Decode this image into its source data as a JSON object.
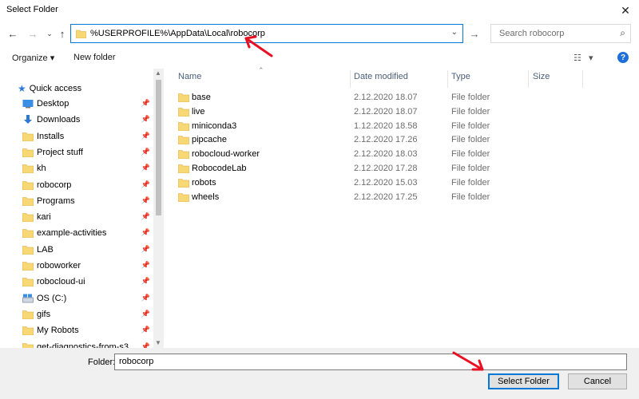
{
  "window": {
    "title": "Select Folder"
  },
  "address": {
    "path": "%USERPROFILE%\\AppData\\Local\\robocorp"
  },
  "search": {
    "placeholder": "Search robocorp"
  },
  "toolbar": {
    "organize": "Organize ▾",
    "new_folder": "New folder",
    "view_label": "▾",
    "help_label": "?"
  },
  "sidebar": {
    "quick_access": "Quick access",
    "items": [
      {
        "label": "Desktop",
        "icon": "desktop-icon"
      },
      {
        "label": "Downloads",
        "icon": "download-icon"
      },
      {
        "label": "Installs",
        "icon": "folder-icon"
      },
      {
        "label": "Project stuff",
        "icon": "folder-icon"
      },
      {
        "label": "kh",
        "icon": "folder-icon"
      },
      {
        "label": "robocorp",
        "icon": "folder-icon"
      },
      {
        "label": "Programs",
        "icon": "folder-icon"
      },
      {
        "label": "kari",
        "icon": "folder-icon"
      },
      {
        "label": "example-activities",
        "icon": "folder-icon"
      },
      {
        "label": "LAB",
        "icon": "folder-icon"
      },
      {
        "label": "roboworker",
        "icon": "folder-icon"
      },
      {
        "label": "robocloud-ui",
        "icon": "folder-icon"
      },
      {
        "label": "OS (C:)",
        "icon": "drive-icon"
      },
      {
        "label": "gifs",
        "icon": "folder-icon"
      },
      {
        "label": "My Robots",
        "icon": "folder-icon"
      },
      {
        "label": "get-diagnostics-from-s3",
        "icon": "folder-icon"
      }
    ]
  },
  "columns": {
    "name": "Name",
    "date": "Date modified",
    "type": "Type",
    "size": "Size"
  },
  "files": [
    {
      "name": "base",
      "date": "2.12.2020 18.07",
      "type": "File folder"
    },
    {
      "name": "live",
      "date": "2.12.2020 18.07",
      "type": "File folder"
    },
    {
      "name": "miniconda3",
      "date": "1.12.2020 18.58",
      "type": "File folder"
    },
    {
      "name": "pipcache",
      "date": "2.12.2020 17.26",
      "type": "File folder"
    },
    {
      "name": "robocloud-worker",
      "date": "2.12.2020 18.03",
      "type": "File folder"
    },
    {
      "name": "RobocodeLab",
      "date": "2.12.2020 17.28",
      "type": "File folder"
    },
    {
      "name": "robots",
      "date": "2.12.2020 15.03",
      "type": "File folder"
    },
    {
      "name": "wheels",
      "date": "2.12.2020 17.25",
      "type": "File folder"
    }
  ],
  "footer": {
    "folder_label": "Folder:",
    "folder_value": "robocorp",
    "select_button": "Select Folder",
    "cancel_button": "Cancel"
  },
  "colors": {
    "accent": "#0078d7",
    "folder": "#f8d775",
    "annotation_arrow": "#e81123"
  }
}
